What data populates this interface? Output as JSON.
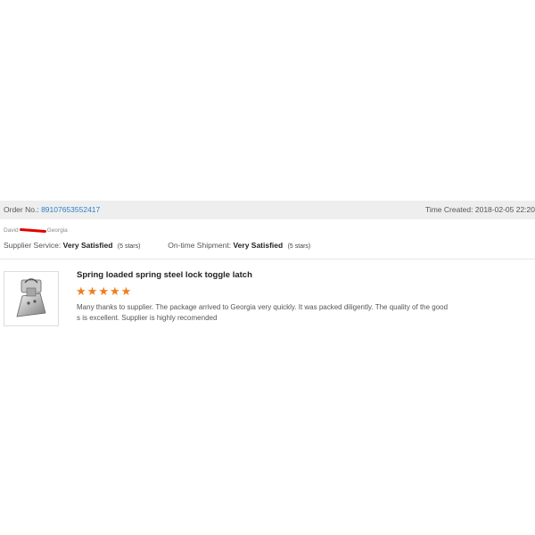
{
  "order": {
    "label": "Order No.:",
    "number": "89107653552417",
    "time_label": "Time Created:",
    "time_value": "2018-02-05 22:20"
  },
  "buyer": {
    "first_name": "David",
    "location": "Georgia"
  },
  "ratings": {
    "supplier_label": "Supplier Service:",
    "supplier_value": "Very Satisfied",
    "supplier_stars": "(5 stars)",
    "shipment_label": "On-time Shipment:",
    "shipment_value": "Very Satisfied",
    "shipment_stars": "(5 stars)"
  },
  "product": {
    "title": "Spring loaded spring steel lock toggle latch",
    "image_icon": "toggle-latch-image",
    "rating": 5,
    "star_color": "#f07c1e",
    "review": "Many thanks to supplier. The package arrived to Georgia very quickly. It was packed diligently. The quality of the goods is excellent. Supplier is highly recomended"
  },
  "colors": {
    "link": "#2e7fc9",
    "order_bar_bg": "#eeeeee"
  }
}
